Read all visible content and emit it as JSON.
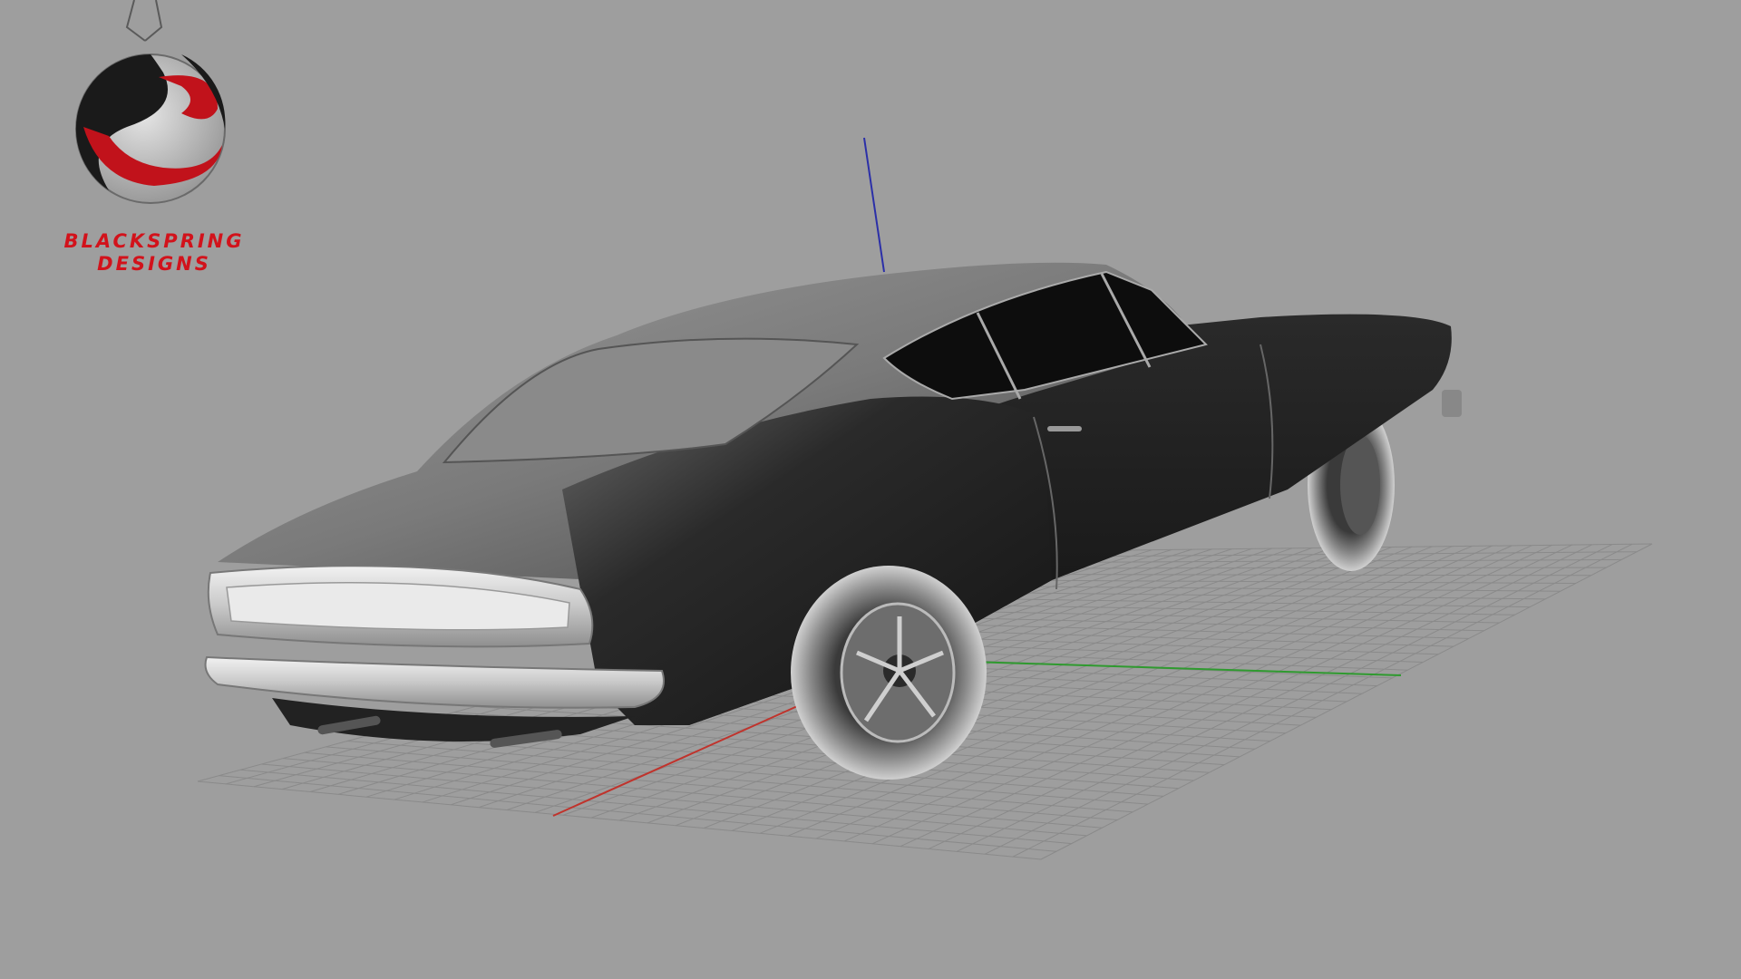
{
  "brand": {
    "line1": "BLACKSPRING",
    "line2": "DESIGNS",
    "accent_color": "#d2121b"
  },
  "viewport": {
    "background_color": "#9e9e9e",
    "grid_color": "#8a8a8a",
    "axis_x_color": "#c0332c",
    "axis_y_color": "#2f9a2f",
    "axis_z_color": "#2b2fa8",
    "model_color": "#1c1c1c",
    "chrome_color": "#d8d8d8"
  }
}
